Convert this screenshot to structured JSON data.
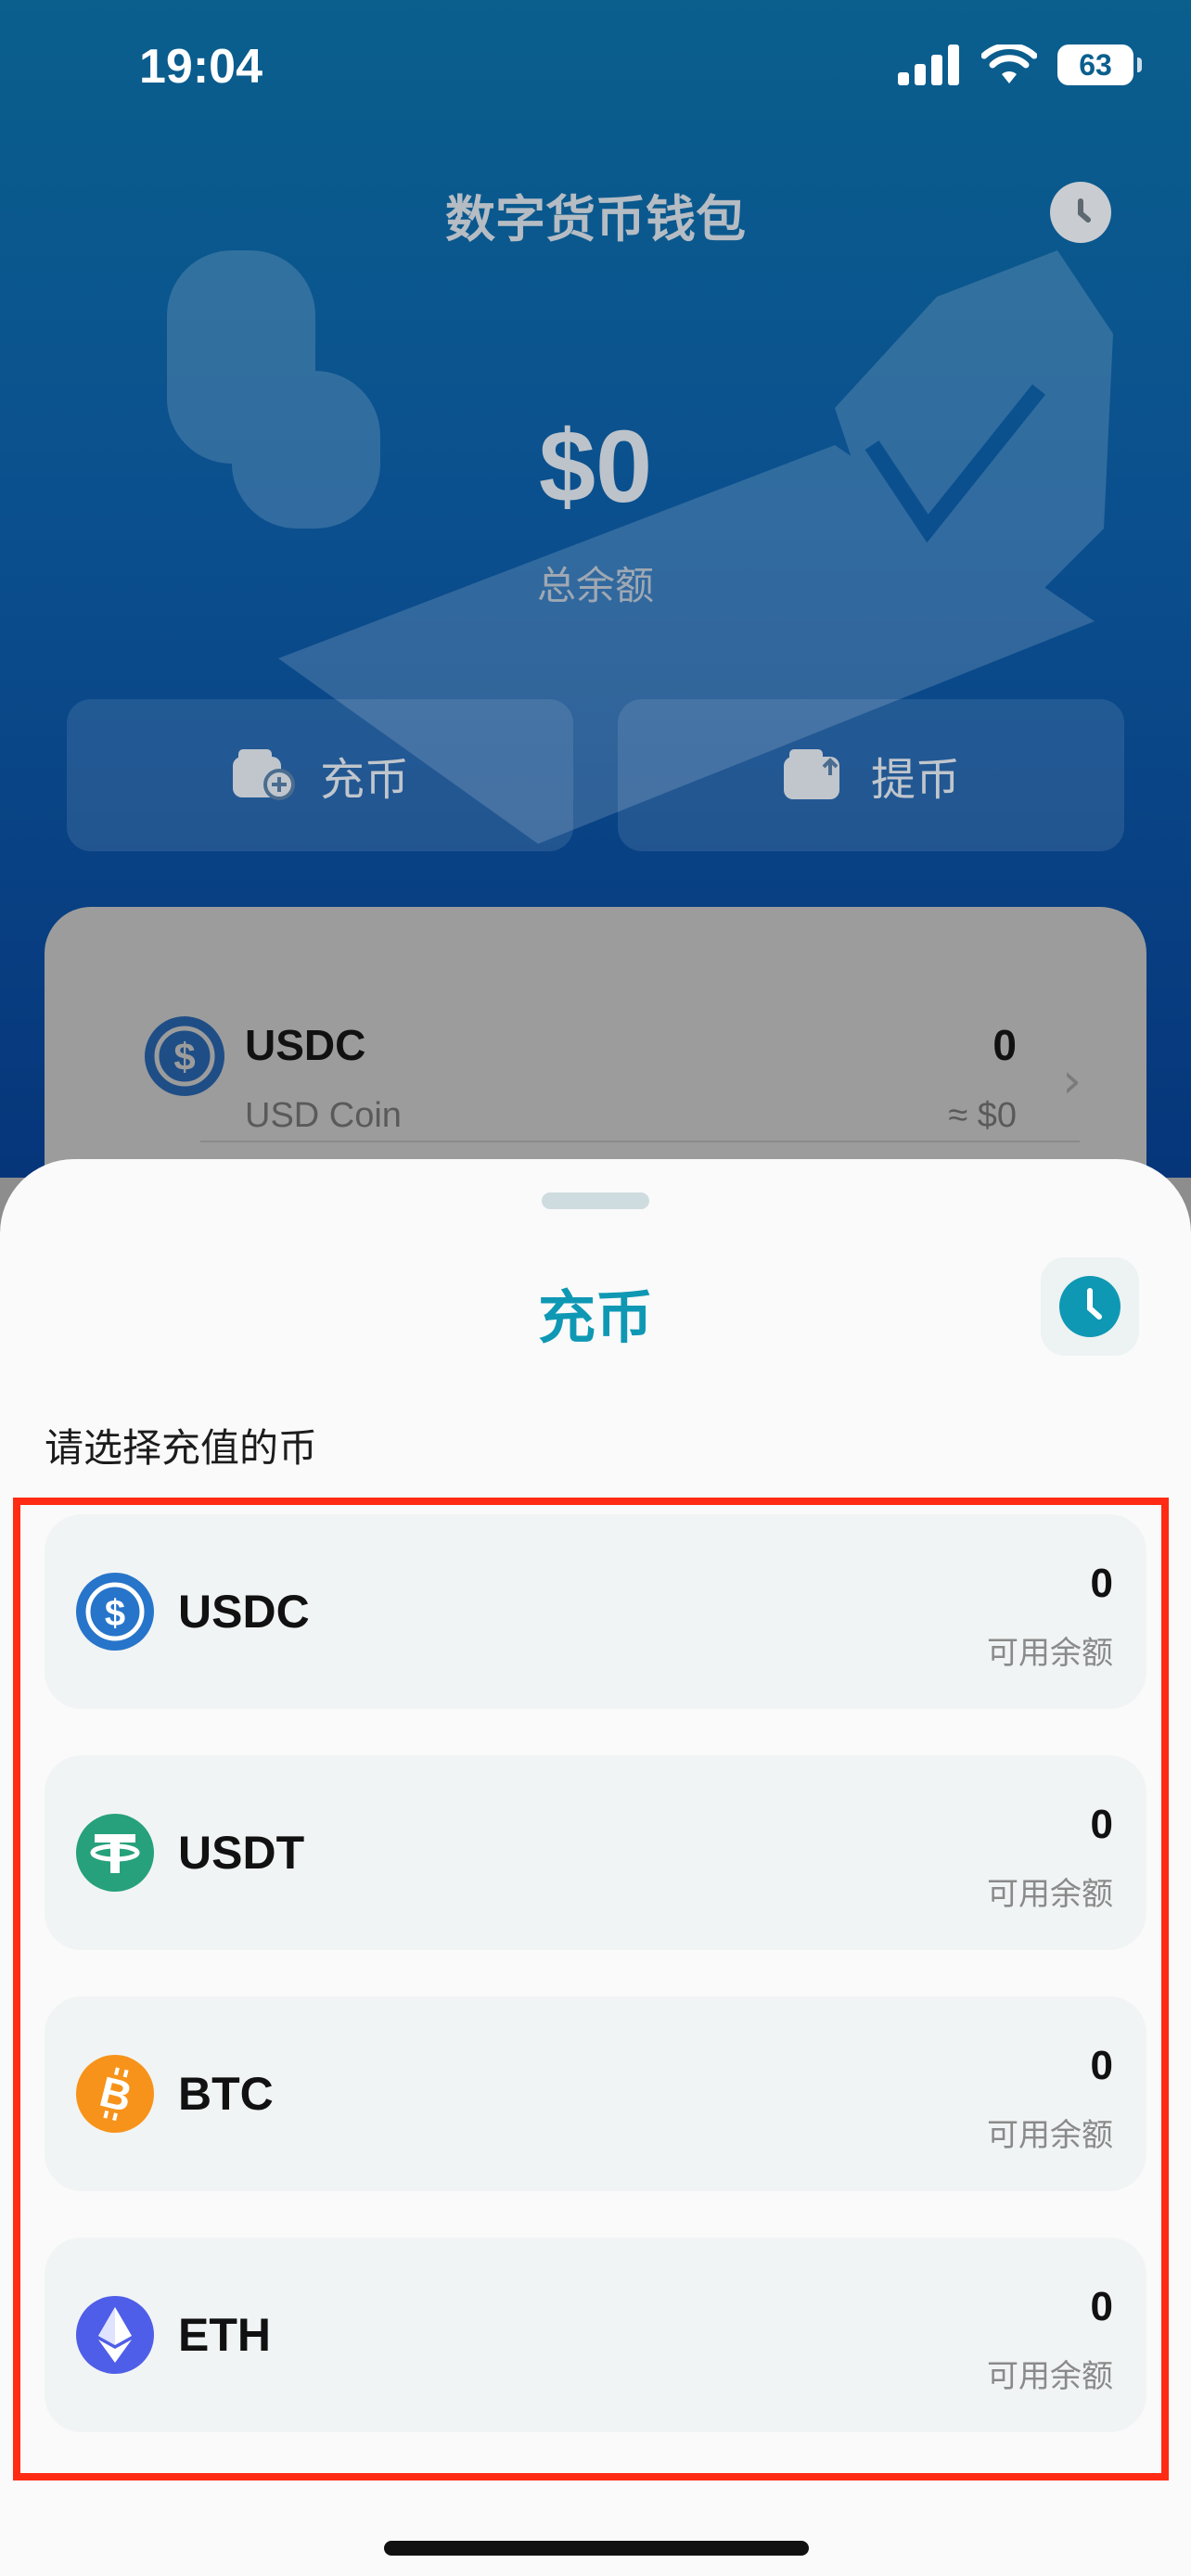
{
  "status_bar": {
    "time": "19:04",
    "battery": "63"
  },
  "wallet": {
    "title": "数字货币钱包",
    "total_balance": "$0",
    "total_balance_label": "总余额",
    "deposit_label": "充币",
    "withdraw_label": "提币",
    "assets": [
      {
        "symbol": "USDC",
        "name": "USD Coin",
        "amount": "0",
        "usd_value": "≈ $0"
      }
    ]
  },
  "deposit_sheet": {
    "title": "充币",
    "subtitle": "请选择充值的币",
    "coins": [
      {
        "symbol": "USDC",
        "amount": "0",
        "available_label": "可用余额",
        "icon": "usdc-icon",
        "color": "#2775ca"
      },
      {
        "symbol": "USDT",
        "amount": "0",
        "available_label": "可用余额",
        "icon": "usdt-icon",
        "color": "#26a17b"
      },
      {
        "symbol": "BTC",
        "amount": "0",
        "available_label": "可用余额",
        "icon": "btc-icon",
        "color": "#f7931a"
      },
      {
        "symbol": "ETH",
        "amount": "0",
        "available_label": "可用余额",
        "icon": "eth-icon",
        "color": "#4f5ee8"
      }
    ]
  },
  "colors": {
    "accent": "#0f98b4",
    "highlight_border": "#ff2b14"
  }
}
